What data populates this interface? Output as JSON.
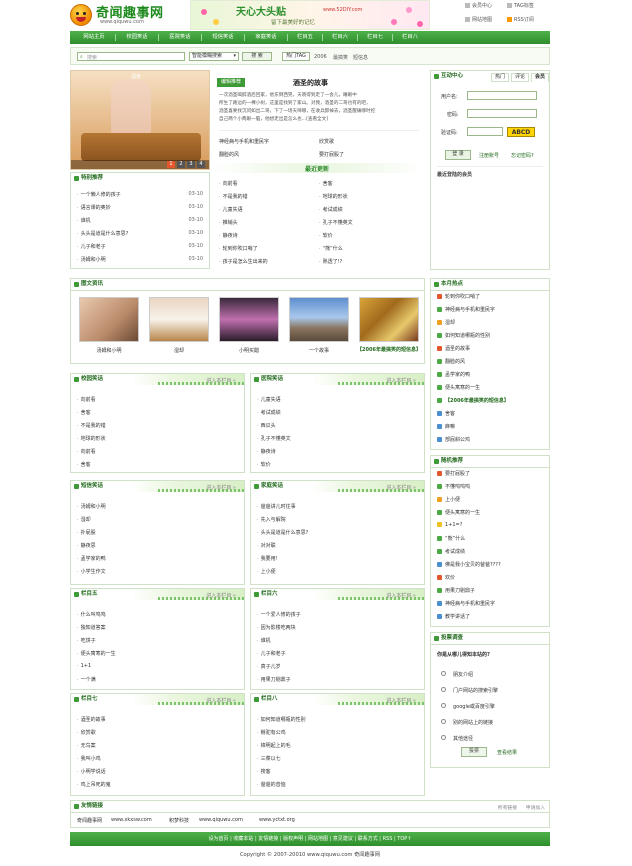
{
  "header": {
    "logo_title": "奇闻趣事网",
    "logo_url": "www.qiquwu.com",
    "banner_title": "天心大头贴",
    "banner_url": "www.52DIY.com",
    "banner_slogan": "留下最美好的记忆",
    "links": [
      "会员中心",
      "TAG标签",
      "网站地图",
      "RSS订阅"
    ]
  },
  "nav": [
    "网站主页",
    "校园笑话",
    "医院笑话",
    "短信笑话",
    "家庭笑话",
    "栏目五",
    "栏目六",
    "栏目七",
    "栏目八"
  ],
  "search": {
    "placeholder": "搜索",
    "select": "智能模糊搜索",
    "button": "搜 索",
    "tag_button": "热门TAG",
    "tags": [
      "2006",
      "最搞笑",
      "短信息"
    ]
  },
  "slideshow": {
    "caption": "湿身",
    "pages": [
      "1",
      "2",
      "3",
      "4"
    ]
  },
  "special": {
    "title": "特别推荐",
    "items": [
      {
        "t": "一个懒人修的孩子",
        "d": "03-10"
      },
      {
        "t": "语言课的奥妙",
        "d": "03-10"
      },
      {
        "t": "谁机",
        "d": "03-10"
      },
      {
        "t": "头头是道是什么意思?",
        "d": "03-10"
      },
      {
        "t": "儿子和老子",
        "d": "03-10"
      },
      {
        "t": "汤姆和小明",
        "d": "03-10"
      }
    ]
  },
  "featured": {
    "badge": "编辑推荐",
    "title": "酒圣的故事",
    "text1": "一次酒圣喝醉酒后回家，他东倒西晃，天晓得到走了一会儿，睡眼中",
    "text2": "所生了路边的一棵小树，这里是找到了家山。对我，酒圣的二哥也有的吧，",
    "text3": "酒圣喜要找沉问如出二哥，下了一场天啼哪，在收兵卸掉去，酒圣醒痛哪时挖",
    "text4": "自己两个小两眼一脑，他想走出是怎么也...[查看全文]",
    "links": [
      "神经病与手机和重民字",
      "欣赏歌",
      "翻脸的风",
      "要打屁股了"
    ]
  },
  "latest": {
    "title": "最近更新",
    "items": [
      "向前看",
      "舍客",
      "不是我的错",
      "地球的形状",
      "儿童失语",
      "考试成绩",
      "推销头",
      "孔子不懂英文",
      "静夜诗",
      "软价",
      "轮到你吹口哨了",
      "“熊”什么",
      "孩子是怎么生出来的",
      "熟透了!?"
    ]
  },
  "member": {
    "title": "互动中心",
    "tabs": [
      "热门",
      "评论",
      "会员"
    ],
    "user_label": "用户名:",
    "pass_label": "密码:",
    "code_label": "验证码:",
    "code": "ABCD",
    "login": "登 录",
    "register": "注册账号",
    "forgot": "忘记密码?",
    "recent": "最近登陆的会员"
  },
  "photos": {
    "title": "图文资讯",
    "items": [
      "汤姆和小明",
      "湿却",
      "小明买醋",
      "一个故事",
      "【2006年最搞笑的短信息】"
    ]
  },
  "hot": {
    "title": "本月热点",
    "items": [
      "轮到你吹口哨了",
      "神经病与手机和重民字",
      "湿却",
      "如何知道哪瓶的性别",
      "酒圣的故事",
      "翻脸的风",
      "孟学家的鸭",
      "便头寓寒的一生",
      "【2006年最搞笑的短信息】",
      "舍客",
      "麻嘛",
      "部屁斜公鸡"
    ]
  },
  "random": {
    "title": "随机推荐",
    "items": [
      "要打屁股了",
      "不懂呜呜呜",
      "上小便",
      "便头寓寒的一生",
      "1+1=?",
      "“熊”什么",
      "考试成绩",
      "佛是我小宝贝的爸爸????",
      "欢价",
      "用果刀剔鼎子",
      "神经病与手机和重民字",
      "教学讲话了"
    ]
  },
  "poll": {
    "title": "投票调查",
    "question": "你是从哪儿得知本站的?",
    "options": [
      "朋友介绍",
      "门户网站的搜索引擎",
      "google或百度引擎",
      "别的网站上的链接",
      "其他途径"
    ],
    "vote": "投票",
    "result": "查看结果"
  },
  "cats": [
    {
      "title": "校园笑话",
      "more": "进入本栏目 »",
      "items": [
        "向前看",
        "舍客",
        "不是我的错",
        "地球的形状",
        "向前看",
        "舍客"
      ]
    },
    {
      "title": "医院笑话",
      "more": "进入本栏目 »",
      "items": [
        "儿童失语",
        "考试成绩",
        "西瓜头",
        "孔子不懂英文",
        "静夜诗",
        "软价"
      ]
    },
    {
      "title": "短信笑话",
      "more": "进入本栏目 »",
      "items": [
        "汤姆和小明",
        "湿却",
        "扑屁股",
        "静夜思",
        "孟学家的鸭",
        "小学生作文"
      ]
    },
    {
      "title": "家庭笑话",
      "more": "进入本栏目 »",
      "items": [
        "爸爸讲儿时往事",
        "先入与解院",
        "头头是道是什么意思?",
        "对对联",
        "我要用!",
        "上小便"
      ]
    },
    {
      "title": "栏目五",
      "more": "进入本栏目 »",
      "items": [
        "什么叫呜呜",
        "独知道答案",
        "吃饼子",
        "便头寓寒的一生",
        "1+1",
        "一个满"
      ]
    },
    {
      "title": "栏目六",
      "more": "进入本栏目 »",
      "items": [
        "一个爱人修的孩子",
        "因为影楼吃两块",
        "谁机",
        "儿子和老子",
        "真子儿岁",
        "用果刀剔鼎子"
      ]
    },
    {
      "title": "栏目七",
      "more": "进入本栏目 »",
      "items": [
        "酒圣的故事",
        "欣赏歌",
        "无鸟案",
        "我叫小鸡",
        "小明学说话",
        "鸡上吊死的鬼"
      ]
    },
    {
      "title": "栏目八",
      "more": "进入本栏目 »",
      "items": [
        "如何知道哪瓶的性别",
        "掰驼有公鸡",
        "锦明起上的毛",
        "三菜以七",
        "搜客",
        "爸爸的音恼"
      ]
    }
  ],
  "friend": {
    "title": "友情链接",
    "right": [
      "所有链接",
      "申请加入"
    ],
    "links": [
      "奇闻趣事网",
      "www.xkxsw.com",
      "积梦科技",
      "www.qiquwu.com",
      "www.yctxt.org"
    ]
  },
  "footer": {
    "nav": "设为首页 | 收藏本站 | 友情链接 | 版权声明 | 网站地图 | 意见建议 | 联系方式 | RSS | TOP↑",
    "copyright": "Copyright © 2007-20010 www.qiquwu.com 奇闻趣事网"
  }
}
